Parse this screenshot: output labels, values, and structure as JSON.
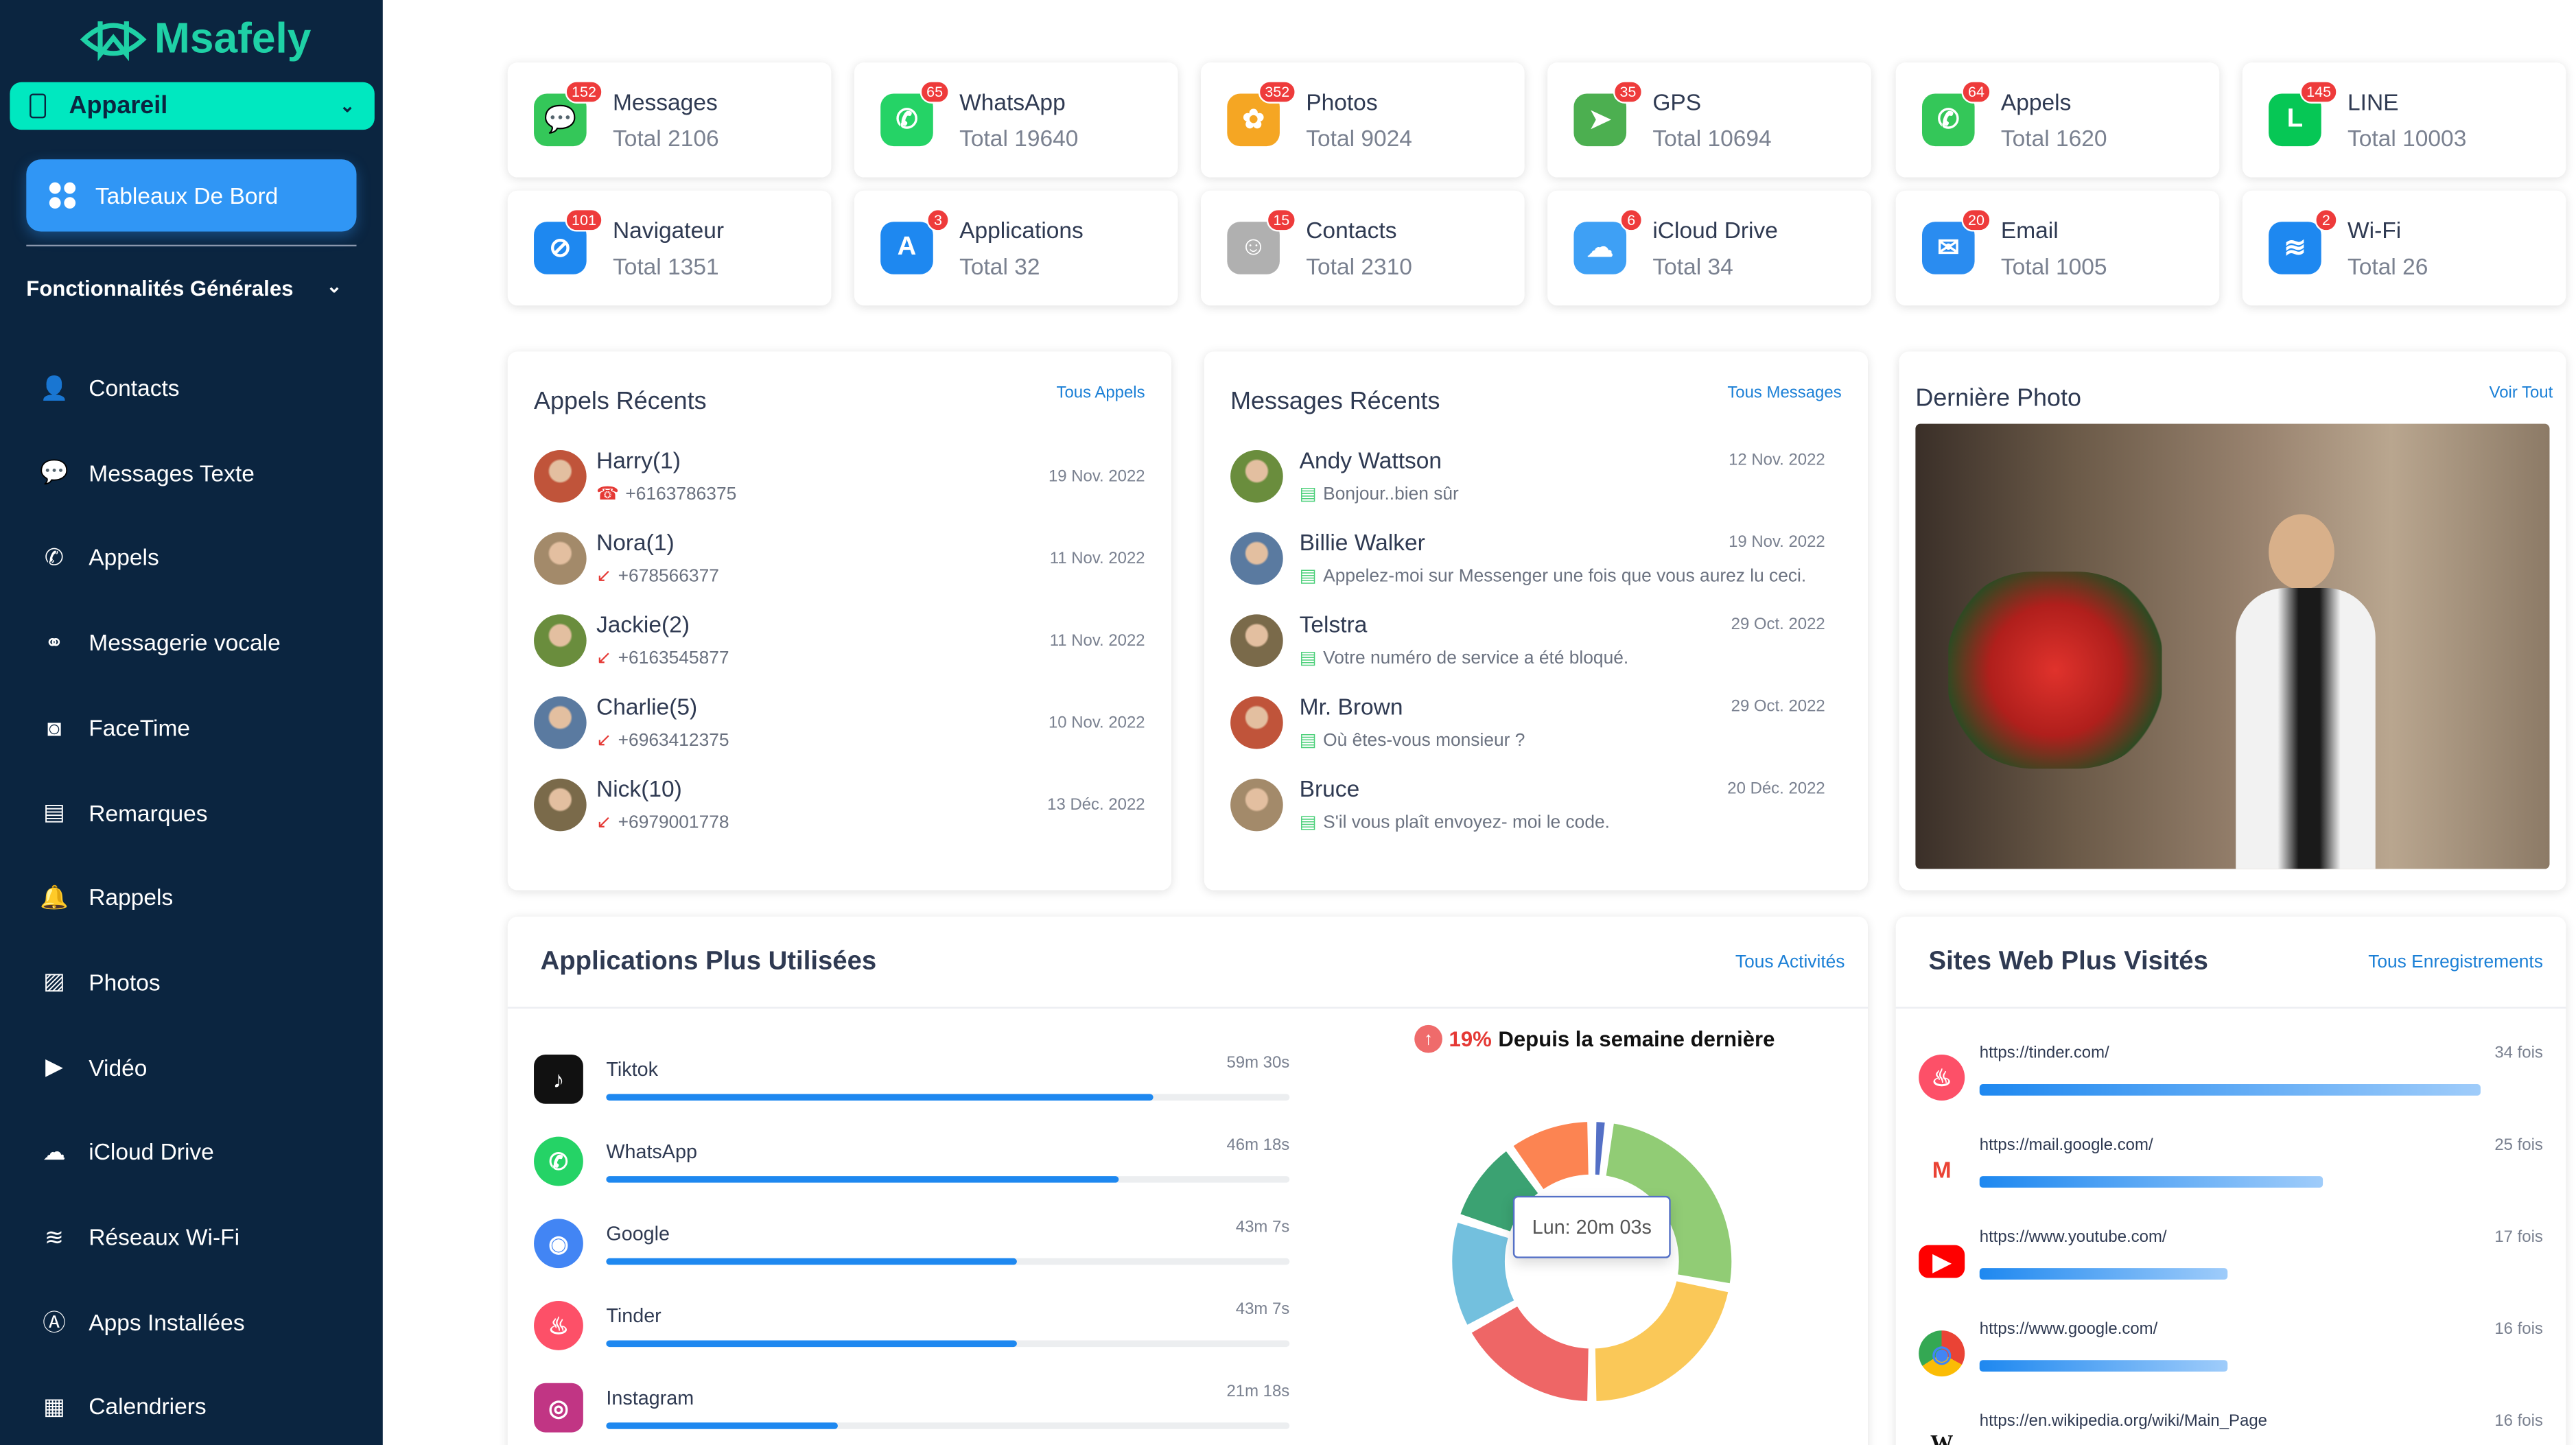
{
  "brand": {
    "name": "Msafely",
    "accent": "#1fd1a6"
  },
  "sidebar": {
    "device": "Appareil",
    "dashboard": "Tableaux De Bord",
    "section": "Fonctionnalités Générales",
    "items": [
      {
        "label": "Contacts",
        "icon": "contact-icon"
      },
      {
        "label": "Messages Texte",
        "icon": "message-icon"
      },
      {
        "label": "Appels",
        "icon": "phone-icon"
      },
      {
        "label": "Messagerie vocale",
        "icon": "voicemail-icon"
      },
      {
        "label": "FaceTime",
        "icon": "facetime-icon"
      },
      {
        "label": "Remarques",
        "icon": "notes-icon"
      },
      {
        "label": "Rappels",
        "icon": "bell-icon"
      },
      {
        "label": "Photos",
        "icon": "photo-icon"
      },
      {
        "label": "Vidéo",
        "icon": "video-icon"
      },
      {
        "label": "iCloud Drive",
        "icon": "cloud-icon"
      },
      {
        "label": "Réseaux Wi-Fi",
        "icon": "wifi-icon"
      },
      {
        "label": "Apps Installées",
        "icon": "apps-icon"
      },
      {
        "label": "Calendriers",
        "icon": "calendar-icon"
      }
    ]
  },
  "stats": [
    {
      "name": "Messages",
      "total": "Total 2106",
      "badge": "152",
      "color": "#34c759",
      "icon": "messages-icon"
    },
    {
      "name": "WhatsApp",
      "total": "Total 19640",
      "badge": "65",
      "color": "#25d366",
      "icon": "whatsapp-icon"
    },
    {
      "name": "Photos",
      "total": "Total 9024",
      "badge": "352",
      "color": "#f5a623",
      "icon": "photos-icon"
    },
    {
      "name": "GPS",
      "total": "Total 10694",
      "badge": "35",
      "color": "#4caf50",
      "icon": "maps-icon"
    },
    {
      "name": "Appels",
      "total": "Total 1620",
      "badge": "64",
      "color": "#34c759",
      "icon": "phone-icon"
    },
    {
      "name": "LINE",
      "total": "Total 10003",
      "badge": "145",
      "color": "#06c755",
      "icon": "line-icon"
    },
    {
      "name": "Navigateur",
      "total": "Total 1351",
      "badge": "101",
      "color": "#1e88f0",
      "icon": "safari-icon"
    },
    {
      "name": "Applications",
      "total": "Total 32",
      "badge": "3",
      "color": "#1e88f0",
      "icon": "appstore-icon"
    },
    {
      "name": "Contacts",
      "total": "Total 2310",
      "badge": "15",
      "color": "#b0b0b0",
      "icon": "contacts-icon"
    },
    {
      "name": "iCloud Drive",
      "total": "Total 34",
      "badge": "6",
      "color": "#3ea0f5",
      "icon": "icloud-icon"
    },
    {
      "name": "Email",
      "total": "Total 1005",
      "badge": "20",
      "color": "#2a8cf0",
      "icon": "mail-icon"
    },
    {
      "name": "Wi-Fi",
      "total": "Total 26",
      "badge": "2",
      "color": "#1e88f0",
      "icon": "wifi-icon"
    }
  ],
  "calls": {
    "title": "Appels Récents",
    "link": "Tous Appels",
    "items": [
      {
        "name": "Harry(1)",
        "number": "+6163786375",
        "date": "19 Nov. 2022",
        "type": "missed"
      },
      {
        "name": "Nora(1)",
        "number": "+678566377",
        "date": "11 Nov. 2022",
        "type": "incoming"
      },
      {
        "name": "Jackie(2)",
        "number": "+6163545877",
        "date": "11 Nov. 2022",
        "type": "incoming"
      },
      {
        "name": "Charlie(5)",
        "number": "+6963412375",
        "date": "10 Nov. 2022",
        "type": "incoming"
      },
      {
        "name": "Nick(10)",
        "number": "+6979001778",
        "date": "13 Déc. 2022",
        "type": "incoming"
      }
    ]
  },
  "messages": {
    "title": "Messages Récents",
    "link": "Tous Messages",
    "items": [
      {
        "name": "Andy Wattson",
        "text": "Bonjour..bien sûr",
        "date": "12 Nov. 2022"
      },
      {
        "name": "Billie Walker",
        "text": "Appelez-moi sur Messenger une fois que vous aurez lu ceci.",
        "date": "19 Nov. 2022"
      },
      {
        "name": "Telstra",
        "text": "Votre numéro de service a été bloqué.",
        "date": "29 Oct. 2022"
      },
      {
        "name": "Mr. Brown",
        "text": "Où êtes-vous monsieur ?",
        "date": "29 Oct. 2022"
      },
      {
        "name": "Bruce",
        "text": "S'il vous plaît envoyez- moi le code.",
        "date": "20 Déc. 2022"
      }
    ]
  },
  "photo": {
    "title": "Dernière Photo",
    "link": "Voir Tout"
  },
  "apps": {
    "title": "Applications Plus Utilisées",
    "link": "Tous Activités",
    "items": [
      {
        "name": "Tiktok",
        "time": "59m 30s",
        "fraction": 0.8,
        "color": "#111",
        "icon": "tiktok-icon"
      },
      {
        "name": "WhatsApp",
        "time": "46m 18s",
        "fraction": 0.75,
        "color": "#25d366",
        "icon": "whatsapp-icon"
      },
      {
        "name": "Google",
        "time": "43m 7s",
        "fraction": 0.6,
        "color": "#4285f4",
        "icon": "chrome-icon"
      },
      {
        "name": "Tinder",
        "time": "43m 7s",
        "fraction": 0.6,
        "color": "#fd5068",
        "icon": "tinder-icon"
      },
      {
        "name": "Instagram",
        "time": "21m 18s",
        "fraction": 0.34,
        "color": "#c13584",
        "icon": "instagram-icon"
      }
    ],
    "trend_pct": "19%",
    "trend_text": "Depuis la semaine dernière",
    "trend_color": "#e53935",
    "tooltip": "Lun: 20m 03s"
  },
  "chart_data": {
    "type": "pie",
    "donut": true,
    "categories": [
      "Lun",
      "",
      "",
      "",
      "",
      "",
      ""
    ],
    "values": [
      2,
      26,
      22,
      17,
      13,
      10,
      10
    ],
    "colors": [
      "#5470c6",
      "#91cc75",
      "#fac858",
      "#ee6666",
      "#73c0de",
      "#3ba272",
      "#fc8452"
    ],
    "tooltip": "Lun: 20m 03s"
  },
  "sites": {
    "title": "Sites Web Plus Visités",
    "link": "Tous Enregistrements",
    "items": [
      {
        "url": "https://tinder.com/",
        "count": "34 fois",
        "fraction": 0.89,
        "icon": "tinder-icon"
      },
      {
        "url": "https://mail.google.com/",
        "count": "25 fois",
        "fraction": 0.61,
        "icon": "gmail-icon"
      },
      {
        "url": "https://www.youtube.com/",
        "count": "17 fois",
        "fraction": 0.44,
        "icon": "youtube-icon"
      },
      {
        "url": "https://www.google.com/",
        "count": "16 fois",
        "fraction": 0.44,
        "icon": "chrome-icon"
      },
      {
        "url": "https://en.wikipedia.org/wiki/Main_Page",
        "count": "16 fois",
        "fraction": 0.44,
        "icon": "wikipedia-icon"
      }
    ]
  }
}
